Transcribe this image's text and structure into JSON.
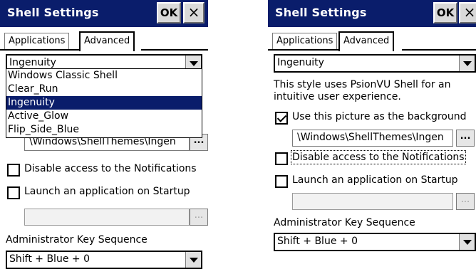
{
  "left": {
    "title": "Shell Settings",
    "ok_label": "OK",
    "close_label": "×",
    "tabs": [
      "Applications",
      "Advanced"
    ],
    "style_select": {
      "value": "Ingenuity"
    },
    "dropdown_options": [
      "Windows Classic Shell",
      "Clear_Run",
      "Ingenuity",
      "Active_Glow",
      "Flip_Side_Blue"
    ],
    "background_path_partial": "\\Windows\\ShellThemes\\Ingen",
    "browse_label": "...",
    "disable_notifications": "Disable access to the Notifications",
    "launch_startup": "Launch an application on Startup",
    "startup_browse_label": "...",
    "admin_key_label": "Administrator Key Sequence",
    "admin_key_value": "Shift + Blue + 0"
  },
  "right": {
    "title": "Shell Settings",
    "ok_label": "OK",
    "close_label": "×",
    "tabs": [
      "Applications",
      "Advanced"
    ],
    "style_select": {
      "value": "Ingenuity"
    },
    "description_line1": "This style uses PsionVU Shell for an",
    "description_line2": "intuitive user experience.",
    "use_picture_label": "Use this picture as the background",
    "background_path": "\\Windows\\ShellThemes\\Ingen",
    "browse_label": "...",
    "disable_notifications": "Disable access to the Notifications",
    "launch_startup": "Launch an application on Startup",
    "startup_browse_label": "...",
    "admin_key_label": "Administrator Key Sequence",
    "admin_key_value": "Shift + Blue + 0"
  },
  "colors": {
    "titlebar": "#0a1d6b",
    "selection": "#0a1d6b"
  }
}
